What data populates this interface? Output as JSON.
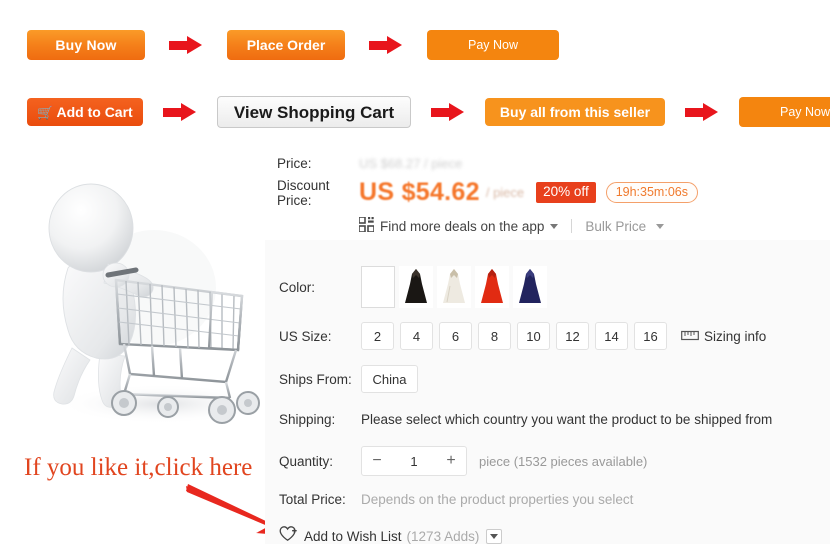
{
  "flow_steps_row1": [
    {
      "label": "Buy Now",
      "icon": null
    },
    {
      "label": "Place Order",
      "icon": null
    },
    {
      "label": "Pay Now",
      "icon": null
    }
  ],
  "flow_steps_row2": [
    {
      "label": "Add to Cart",
      "icon": "shopping-cart-icon"
    },
    {
      "label": "View Shopping Cart",
      "icon": null
    },
    {
      "label": "Buy all from this seller",
      "icon": null
    },
    {
      "label": "Pay Now",
      "icon": null
    }
  ],
  "annotation": {
    "text": "If you like it,click here",
    "color": "#e1451f",
    "arrow_icon": "red-arrow-pointing-down-right"
  },
  "illustration": {
    "name": "3d-person-pushing-shopping-cart"
  },
  "price": {
    "label": "Price:",
    "original": "US $68.27 / piece",
    "discount_label_line1": "Discount",
    "discount_label_line2": "Price:",
    "discount_amount": "US $54.62",
    "unit": "/ piece",
    "off_badge": "20% off",
    "countdown": "19h:35m:06s",
    "badge_color": "#e8401c",
    "price_color": "#f5762a"
  },
  "app_deals": {
    "icon": "qr-code-icon",
    "label": "Find more deals on the app",
    "bulk_price_label": "Bulk Price"
  },
  "options": {
    "color": {
      "label": "Color:",
      "swatches": [
        {
          "name": "empty-swatch",
          "color": "#ffffff",
          "accent": "#ffffff"
        },
        {
          "name": "black-dress-swatch",
          "color": "#1a1714",
          "accent": "#3b332c"
        },
        {
          "name": "ivory-dress-swatch",
          "color": "#eeeae1",
          "accent": "#c9bfa9"
        },
        {
          "name": "red-dress-swatch",
          "color": "#e12b12",
          "accent": "#b52010"
        },
        {
          "name": "navy-dress-swatch",
          "color": "#22245e",
          "accent": "#3a3c7d"
        }
      ]
    },
    "size": {
      "label": "US Size:",
      "values": [
        "2",
        "4",
        "6",
        "8",
        "10",
        "12",
        "14",
        "16"
      ],
      "sizing_info_label": "Sizing info",
      "sizing_info_icon": "ruler-icon"
    },
    "ships_from": {
      "label": "Ships From:",
      "value": "China"
    },
    "shipping": {
      "label": "Shipping:",
      "message": "Please select which country you want the product to be shipped from"
    },
    "quantity": {
      "label": "Quantity:",
      "minus": "−",
      "value": "1",
      "plus": "+",
      "note": "piece (1532 pieces available)"
    },
    "total_price": {
      "label": "Total Price:",
      "note": "Depends on the product properties you select"
    },
    "wishlist": {
      "icon": "heart-plus-icon",
      "label": "Add to Wish List",
      "count": "(1273 Adds)",
      "caret_icon": "chevron-down-icon"
    }
  }
}
